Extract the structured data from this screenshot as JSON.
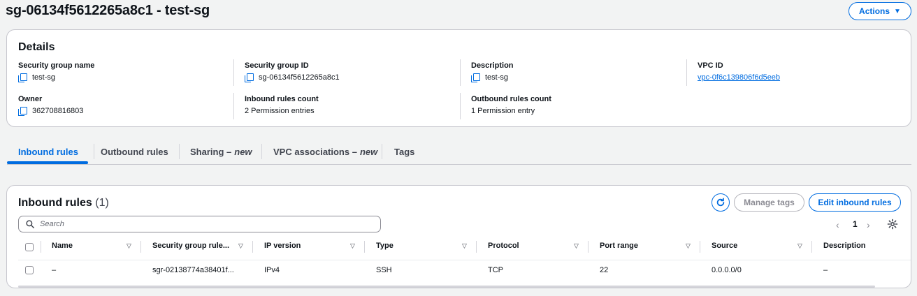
{
  "header": {
    "title": "sg-06134f5612265a8c1 - test-sg",
    "actions_label": "Actions"
  },
  "details": {
    "title": "Details",
    "fields": {
      "sg_name": {
        "label": "Security group name",
        "value": "test-sg"
      },
      "sg_id": {
        "label": "Security group ID",
        "value": "sg-06134f5612265a8c1"
      },
      "description": {
        "label": "Description",
        "value": "test-sg"
      },
      "vpc_id": {
        "label": "VPC ID",
        "value": "vpc-0f6c139806f6d5eeb"
      },
      "owner": {
        "label": "Owner",
        "value": "362708816803"
      },
      "inbound_count": {
        "label": "Inbound rules count",
        "value": "2 Permission entries"
      },
      "outbound_count": {
        "label": "Outbound rules count",
        "value": "1 Permission entry"
      }
    }
  },
  "tabs": {
    "inbound": "Inbound rules",
    "outbound": "Outbound rules",
    "sharing": "Sharing –",
    "sharing_badge": "new",
    "vpc_assoc": "VPC associations –",
    "vpc_assoc_badge": "new",
    "tags": "Tags"
  },
  "rules": {
    "title": "Inbound rules",
    "count": "(1)",
    "manage_tags_label": "Manage tags",
    "edit_label": "Edit inbound rules",
    "search_placeholder": "Search",
    "page": "1",
    "columns": {
      "name": "Name",
      "rule_id": "Security group rule...",
      "ip_version": "IP version",
      "type": "Type",
      "protocol": "Protocol",
      "port_range": "Port range",
      "source": "Source",
      "description": "Description"
    },
    "rows": [
      {
        "name": "–",
        "rule_id": "sgr-02138774a38401f...",
        "ip_version": "IPv4",
        "type": "SSH",
        "protocol": "TCP",
        "port_range": "22",
        "source": "0.0.0.0/0",
        "description": "–"
      }
    ]
  },
  "colors": {
    "accent": "#006ce0",
    "text": "#0f141a",
    "border": "#c6c6cd",
    "background": "#f2f3f3"
  }
}
